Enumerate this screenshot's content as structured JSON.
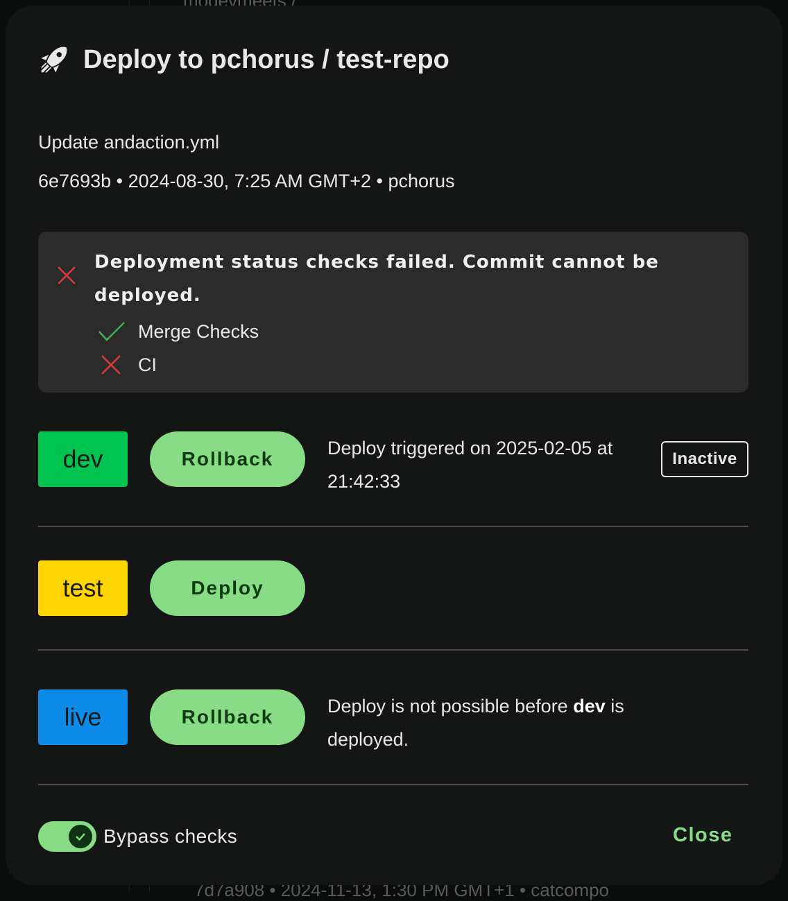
{
  "backdrop": {
    "top_text": "modevmeets /",
    "bottom_text": "7d7a908 • 2024-11-13, 1:30 PM GMT+1 • catcompo"
  },
  "dialog": {
    "title": "Deploy to pchorus / test-repo",
    "title_icon": "rocket-icon",
    "commit_message": "Update andaction.yml",
    "commit_meta": "6e7693b • 2024-08-30, 7:25 AM GMT+2 • pchorus"
  },
  "alert": {
    "title": "Deployment status checks failed. Commit cannot be deployed.",
    "status_icon": "x-icon",
    "error_color": "#d63a3a",
    "success_color": "#3fae5a",
    "checks": [
      {
        "label": "Merge Checks",
        "status": "passed",
        "icon": "check-icon"
      },
      {
        "label": "CI",
        "status": "failed",
        "icon": "x-icon"
      }
    ]
  },
  "environments": [
    {
      "name": "dev",
      "color": "#00c450",
      "button": "Rollback",
      "status_text": "Deploy triggered on 2025-02-05 at 21:42:33",
      "badge": "Inactive"
    },
    {
      "name": "test",
      "color": "#ffd500",
      "button": "Deploy"
    },
    {
      "name": "live",
      "color": "#0c8ce8",
      "button": "Rollback",
      "status_prefix": "Deploy is not possible before ",
      "status_bold": "dev",
      "status_suffix": " is deployed."
    }
  ],
  "footer": {
    "bypass_label": "Bypass checks",
    "bypass_checked": true,
    "close_label": "Close"
  },
  "colors": {
    "accent": "#88dc86",
    "dialog_bg": "#141615",
    "alert_bg": "#2a2b2a"
  }
}
